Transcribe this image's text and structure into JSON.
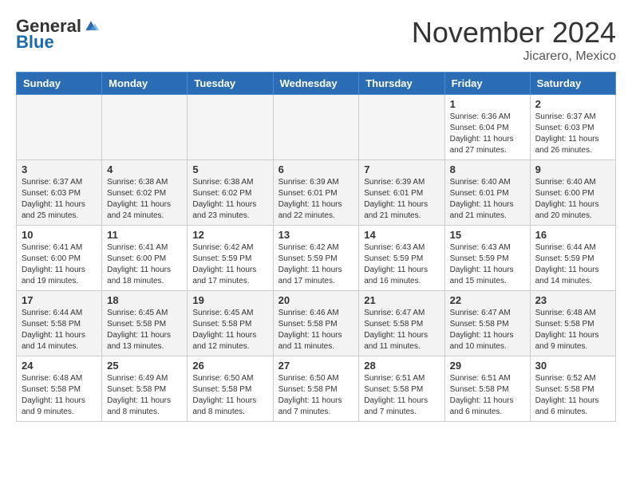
{
  "logo": {
    "general": "General",
    "blue": "Blue"
  },
  "title": "November 2024",
  "location": "Jicarero, Mexico",
  "days_of_week": [
    "Sunday",
    "Monday",
    "Tuesday",
    "Wednesday",
    "Thursday",
    "Friday",
    "Saturday"
  ],
  "weeks": [
    {
      "days": [
        {
          "num": "",
          "info": ""
        },
        {
          "num": "",
          "info": ""
        },
        {
          "num": "",
          "info": ""
        },
        {
          "num": "",
          "info": ""
        },
        {
          "num": "",
          "info": ""
        },
        {
          "num": "1",
          "info": "Sunrise: 6:36 AM\nSunset: 6:04 PM\nDaylight: 11 hours\nand 27 minutes."
        },
        {
          "num": "2",
          "info": "Sunrise: 6:37 AM\nSunset: 6:03 PM\nDaylight: 11 hours\nand 26 minutes."
        }
      ]
    },
    {
      "days": [
        {
          "num": "3",
          "info": "Sunrise: 6:37 AM\nSunset: 6:03 PM\nDaylight: 11 hours\nand 25 minutes."
        },
        {
          "num": "4",
          "info": "Sunrise: 6:38 AM\nSunset: 6:02 PM\nDaylight: 11 hours\nand 24 minutes."
        },
        {
          "num": "5",
          "info": "Sunrise: 6:38 AM\nSunset: 6:02 PM\nDaylight: 11 hours\nand 23 minutes."
        },
        {
          "num": "6",
          "info": "Sunrise: 6:39 AM\nSunset: 6:01 PM\nDaylight: 11 hours\nand 22 minutes."
        },
        {
          "num": "7",
          "info": "Sunrise: 6:39 AM\nSunset: 6:01 PM\nDaylight: 11 hours\nand 21 minutes."
        },
        {
          "num": "8",
          "info": "Sunrise: 6:40 AM\nSunset: 6:01 PM\nDaylight: 11 hours\nand 21 minutes."
        },
        {
          "num": "9",
          "info": "Sunrise: 6:40 AM\nSunset: 6:00 PM\nDaylight: 11 hours\nand 20 minutes."
        }
      ]
    },
    {
      "days": [
        {
          "num": "10",
          "info": "Sunrise: 6:41 AM\nSunset: 6:00 PM\nDaylight: 11 hours\nand 19 minutes."
        },
        {
          "num": "11",
          "info": "Sunrise: 6:41 AM\nSunset: 6:00 PM\nDaylight: 11 hours\nand 18 minutes."
        },
        {
          "num": "12",
          "info": "Sunrise: 6:42 AM\nSunset: 5:59 PM\nDaylight: 11 hours\nand 17 minutes."
        },
        {
          "num": "13",
          "info": "Sunrise: 6:42 AM\nSunset: 5:59 PM\nDaylight: 11 hours\nand 17 minutes."
        },
        {
          "num": "14",
          "info": "Sunrise: 6:43 AM\nSunset: 5:59 PM\nDaylight: 11 hours\nand 16 minutes."
        },
        {
          "num": "15",
          "info": "Sunrise: 6:43 AM\nSunset: 5:59 PM\nDaylight: 11 hours\nand 15 minutes."
        },
        {
          "num": "16",
          "info": "Sunrise: 6:44 AM\nSunset: 5:59 PM\nDaylight: 11 hours\nand 14 minutes."
        }
      ]
    },
    {
      "days": [
        {
          "num": "17",
          "info": "Sunrise: 6:44 AM\nSunset: 5:58 PM\nDaylight: 11 hours\nand 14 minutes."
        },
        {
          "num": "18",
          "info": "Sunrise: 6:45 AM\nSunset: 5:58 PM\nDaylight: 11 hours\nand 13 minutes."
        },
        {
          "num": "19",
          "info": "Sunrise: 6:45 AM\nSunset: 5:58 PM\nDaylight: 11 hours\nand 12 minutes."
        },
        {
          "num": "20",
          "info": "Sunrise: 6:46 AM\nSunset: 5:58 PM\nDaylight: 11 hours\nand 11 minutes."
        },
        {
          "num": "21",
          "info": "Sunrise: 6:47 AM\nSunset: 5:58 PM\nDaylight: 11 hours\nand 11 minutes."
        },
        {
          "num": "22",
          "info": "Sunrise: 6:47 AM\nSunset: 5:58 PM\nDaylight: 11 hours\nand 10 minutes."
        },
        {
          "num": "23",
          "info": "Sunrise: 6:48 AM\nSunset: 5:58 PM\nDaylight: 11 hours\nand 9 minutes."
        }
      ]
    },
    {
      "days": [
        {
          "num": "24",
          "info": "Sunrise: 6:48 AM\nSunset: 5:58 PM\nDaylight: 11 hours\nand 9 minutes."
        },
        {
          "num": "25",
          "info": "Sunrise: 6:49 AM\nSunset: 5:58 PM\nDaylight: 11 hours\nand 8 minutes."
        },
        {
          "num": "26",
          "info": "Sunrise: 6:50 AM\nSunset: 5:58 PM\nDaylight: 11 hours\nand 8 minutes."
        },
        {
          "num": "27",
          "info": "Sunrise: 6:50 AM\nSunset: 5:58 PM\nDaylight: 11 hours\nand 7 minutes."
        },
        {
          "num": "28",
          "info": "Sunrise: 6:51 AM\nSunset: 5:58 PM\nDaylight: 11 hours\nand 7 minutes."
        },
        {
          "num": "29",
          "info": "Sunrise: 6:51 AM\nSunset: 5:58 PM\nDaylight: 11 hours\nand 6 minutes."
        },
        {
          "num": "30",
          "info": "Sunrise: 6:52 AM\nSunset: 5:58 PM\nDaylight: 11 hours\nand 6 minutes."
        }
      ]
    }
  ]
}
